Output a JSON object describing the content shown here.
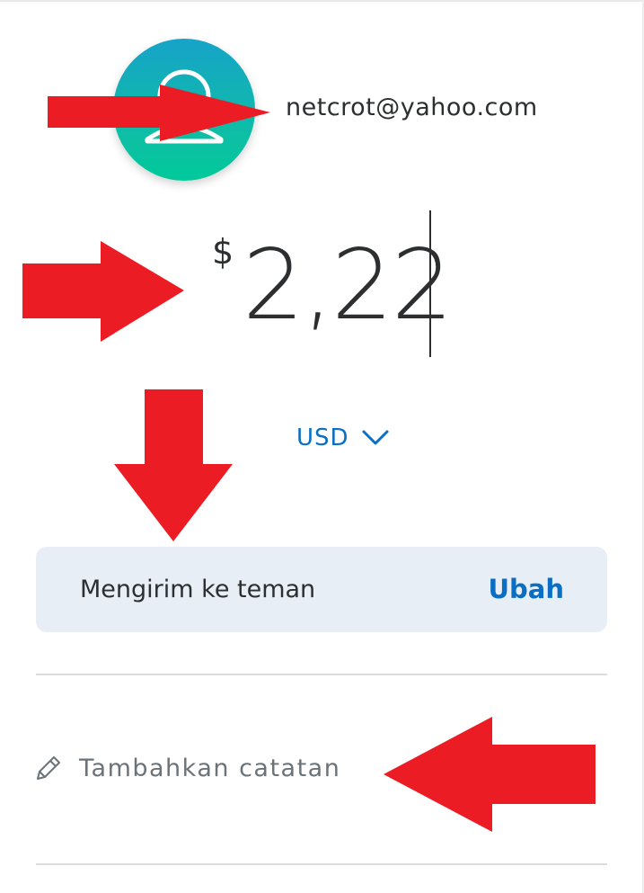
{
  "recipient": {
    "avatar_icon": "person-icon",
    "email": "netcrot@yahoo.com"
  },
  "amount": {
    "symbol": "$",
    "value": "2,22"
  },
  "currency": {
    "code": "USD",
    "icon": "chevron-down-icon"
  },
  "payment_type": {
    "label": "Mengirim ke teman",
    "change_label": "Ubah"
  },
  "note": {
    "icon": "pencil-icon",
    "placeholder": "Tambahkan catatan"
  },
  "colors": {
    "accent": "#0a6ec2",
    "annotation_arrow": "#ec1c24",
    "avatar_top": "#16a3c8",
    "avatar_bottom": "#00c99a",
    "type_box_bg": "#e8eef6"
  }
}
